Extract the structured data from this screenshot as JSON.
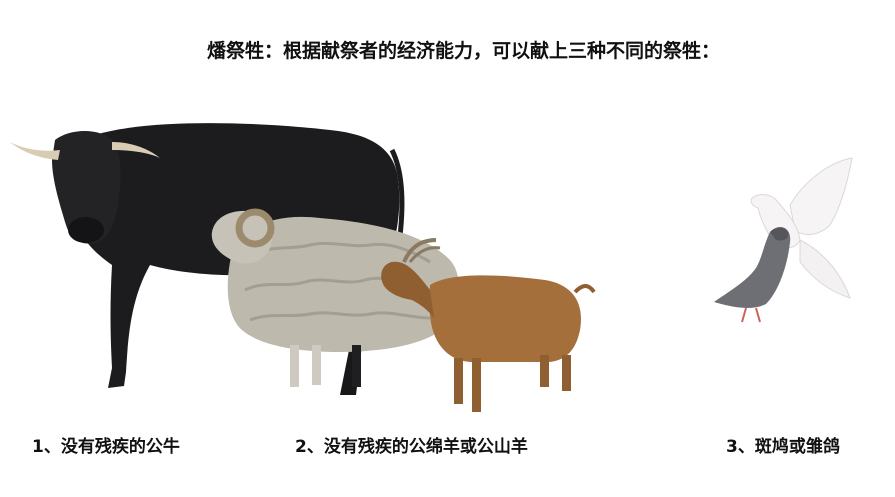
{
  "title": "燔祭牲：根据献祭者的经济能力，可以献上三种不同的祭牲：",
  "captions": [
    "1、没有残疾的公牛",
    "2、没有残疾的公绵羊或公山羊",
    "3、斑鸠或雏鸽"
  ],
  "images": [
    {
      "subject": "bull",
      "icon": "bull-icon"
    },
    {
      "subject": "ram",
      "icon": "ram-icon"
    },
    {
      "subject": "goat",
      "icon": "goat-icon"
    },
    {
      "subject": "pigeons",
      "icon": "dove-icon"
    }
  ],
  "colors": {
    "bull": "#1c1c1e",
    "horn": "#d8ccb3",
    "ram_wool": "#bdb9ad",
    "goat": "#a56f3c",
    "dove_white": "#f6f4f4",
    "pigeon_grey": "#6e6f74"
  }
}
